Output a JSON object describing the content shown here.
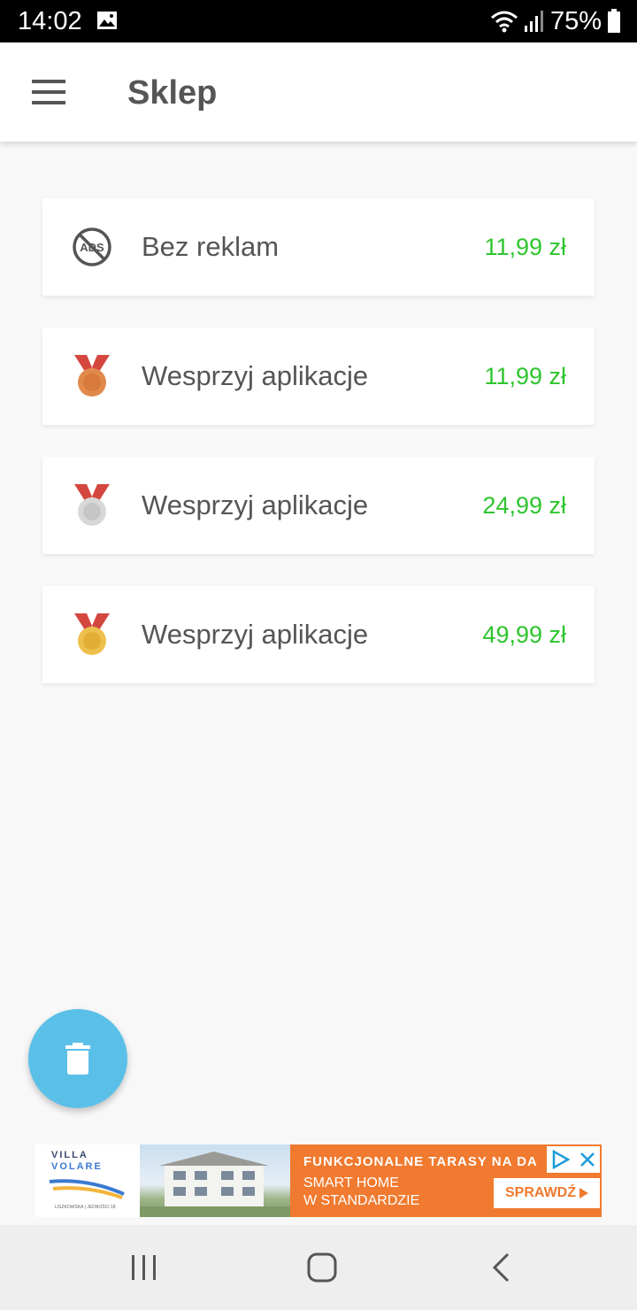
{
  "status_bar": {
    "time": "14:02",
    "battery_text": "75%",
    "icons": [
      "image-icon",
      "wifi-icon",
      "signal-icon",
      "battery-icon"
    ]
  },
  "app_bar": {
    "title": "Sklep",
    "menu_icon": "hamburger-menu-icon"
  },
  "products": [
    {
      "icon": "no-ads-icon",
      "label": "Bez reklam",
      "price": "11,99 zł"
    },
    {
      "icon": "bronze-medal-icon",
      "label": "Wesprzyj aplikacje",
      "price": "11,99 zł"
    },
    {
      "icon": "silver-medal-icon",
      "label": "Wesprzyj aplikacje",
      "price": "24,99 zł"
    },
    {
      "icon": "gold-medal-icon",
      "label": "Wesprzyj aplikacje",
      "price": "49,99 zł"
    }
  ],
  "fab": {
    "icon": "trash-icon"
  },
  "ad_banner": {
    "brand_line1": "VILLA",
    "brand_line2": "VOLARE",
    "brand_small": "LISZKOWSKA | JEDNOŚCI 18",
    "headline": "FUNKCJONALNE TARASY NA DA",
    "subline1": "SMART HOME",
    "subline2": "W STANDARDZIE",
    "cta": "SPRAWDŹ"
  },
  "nav_bar": {
    "buttons": [
      "recent-apps-icon",
      "home-icon",
      "back-icon"
    ]
  },
  "colors": {
    "price": "#2ec52e",
    "fab": "#5bc0e8",
    "ad_orange": "#f07a2f",
    "bronze": "#e08a4c",
    "silver": "#d8d8d8",
    "gold": "#edc04d",
    "ribbon": "#d4473f"
  }
}
